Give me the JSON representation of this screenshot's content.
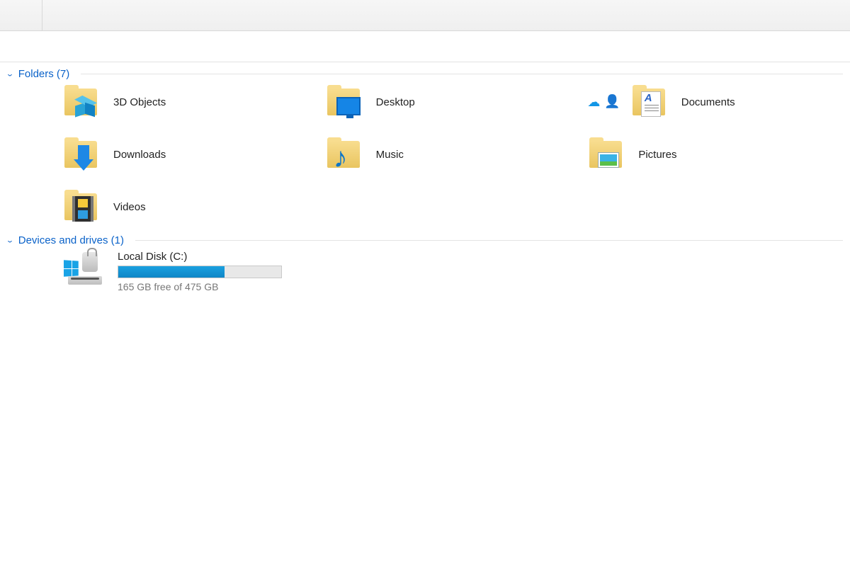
{
  "sections": {
    "folders": {
      "title": "Folders (7)"
    },
    "drives": {
      "title": "Devices and drives (1)"
    }
  },
  "folders": [
    {
      "label": "3D Objects",
      "icon": "cube"
    },
    {
      "label": "Desktop",
      "icon": "monitor"
    },
    {
      "label": "Documents",
      "icon": "doc",
      "status": {
        "cloud": true,
        "shared": true
      }
    },
    {
      "label": "Downloads",
      "icon": "arrow"
    },
    {
      "label": "Music",
      "icon": "note"
    },
    {
      "label": "Pictures",
      "icon": "photo"
    },
    {
      "label": "Videos",
      "icon": "film"
    }
  ],
  "drives": [
    {
      "label": "Local Disk (C:)",
      "subtext": "165 GB free of 475 GB",
      "used_pct": 65,
      "color": "#1aa0e0"
    }
  ]
}
